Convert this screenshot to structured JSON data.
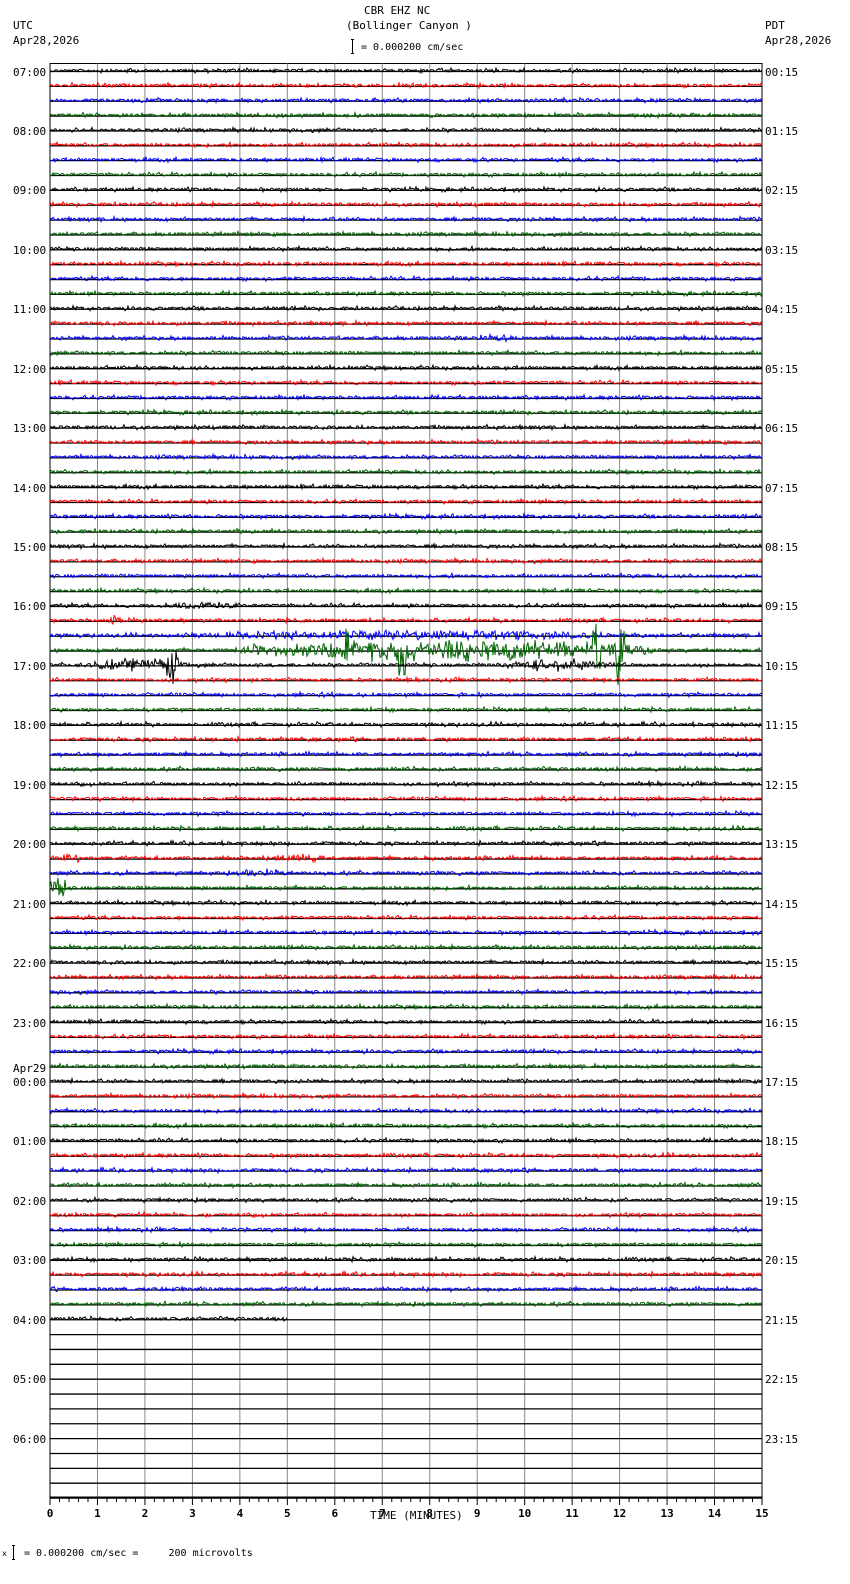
{
  "header": {
    "station": "CBR EHZ NC",
    "location": "(Bollinger Canyon )",
    "left_tz": "UTC",
    "left_date": "Apr28,2026",
    "right_tz": "PDT",
    "right_date": "Apr28,2026",
    "scale": "= 0.000200 cm/sec"
  },
  "footer": {
    "scale": "= 0.000200 cm/sec =     200 microvolts"
  },
  "chart_data": {
    "type": "line",
    "title": "CBR EHZ NC (Bollinger Canyon )",
    "xlabel": "TIME (MINUTES)",
    "xlim": [
      0,
      15
    ],
    "x_ticks": [
      "0",
      "1",
      "2",
      "3",
      "4",
      "5",
      "6",
      "7",
      "8",
      "9",
      "10",
      "11",
      "12",
      "13",
      "14",
      "15"
    ],
    "trace_minutes": 15,
    "trace_count": 96,
    "traces_with_data": 85,
    "last_trace_data_end_minute": 5,
    "trace_colors": [
      "#000000",
      "#ff0000",
      "#0000ff",
      "#006400"
    ],
    "left_labels": [
      "07:00",
      "08:00",
      "09:00",
      "10:00",
      "11:00",
      "12:00",
      "13:00",
      "14:00",
      "15:00",
      "16:00",
      "17:00",
      "18:00",
      "19:00",
      "20:00",
      "21:00",
      "22:00",
      "23:00",
      "00:00",
      "01:00",
      "02:00",
      "03:00",
      "04:00",
      "05:00",
      "06:00"
    ],
    "date_change_label": "Apr29",
    "right_labels": [
      "00:15",
      "01:15",
      "02:15",
      "03:15",
      "04:15",
      "05:15",
      "06:15",
      "07:15",
      "08:15",
      "09:15",
      "10:15",
      "11:15",
      "12:15",
      "13:15",
      "14:15",
      "15:15",
      "16:15",
      "17:15",
      "18:15",
      "19:15",
      "20:15",
      "21:15",
      "22:15",
      "23:15"
    ],
    "events": [
      {
        "trace": 36,
        "start": 2.3,
        "end": 4.0,
        "amp": 4
      },
      {
        "trace": 37,
        "start": 1.2,
        "end": 1.5,
        "amp": 7
      },
      {
        "trace": 38,
        "start": 2.4,
        "end": 12.6,
        "amp": 4
      },
      {
        "trace": 39,
        "start": 4.0,
        "end": 12.7,
        "amp": 9
      },
      {
        "trace": 39,
        "start": 7.3,
        "end": 7.5,
        "amp": 35
      },
      {
        "trace": 39,
        "start": 11.9,
        "end": 12.1,
        "amp": 40
      },
      {
        "trace": 39,
        "start": 11.4,
        "end": 11.6,
        "amp": 30
      },
      {
        "trace": 39,
        "start": 6.2,
        "end": 6.3,
        "amp": 28
      },
      {
        "trace": 40,
        "start": 0.6,
        "end": 3.0,
        "amp": 5
      },
      {
        "trace": 40,
        "start": 2.4,
        "end": 2.7,
        "amp": 15
      },
      {
        "trace": 40,
        "start": 9.5,
        "end": 12.0,
        "amp": 5
      },
      {
        "trace": 53,
        "start": 0.2,
        "end": 0.7,
        "amp": 5
      },
      {
        "trace": 53,
        "start": 4.7,
        "end": 5.8,
        "amp": 4
      },
      {
        "trace": 54,
        "start": 4.0,
        "end": 5.0,
        "amp": 4
      },
      {
        "trace": 55,
        "start": 0.0,
        "end": 0.4,
        "amp": 10
      },
      {
        "trace": 18,
        "start": 8.6,
        "end": 10.0,
        "amp": 3
      },
      {
        "trace": 73,
        "start": 6.3,
        "end": 6.8,
        "amp": 2
      },
      {
        "trace": 82,
        "start": 2.0,
        "end": 3.0,
        "amp": 2
      }
    ],
    "noise_amp": 1.3
  }
}
